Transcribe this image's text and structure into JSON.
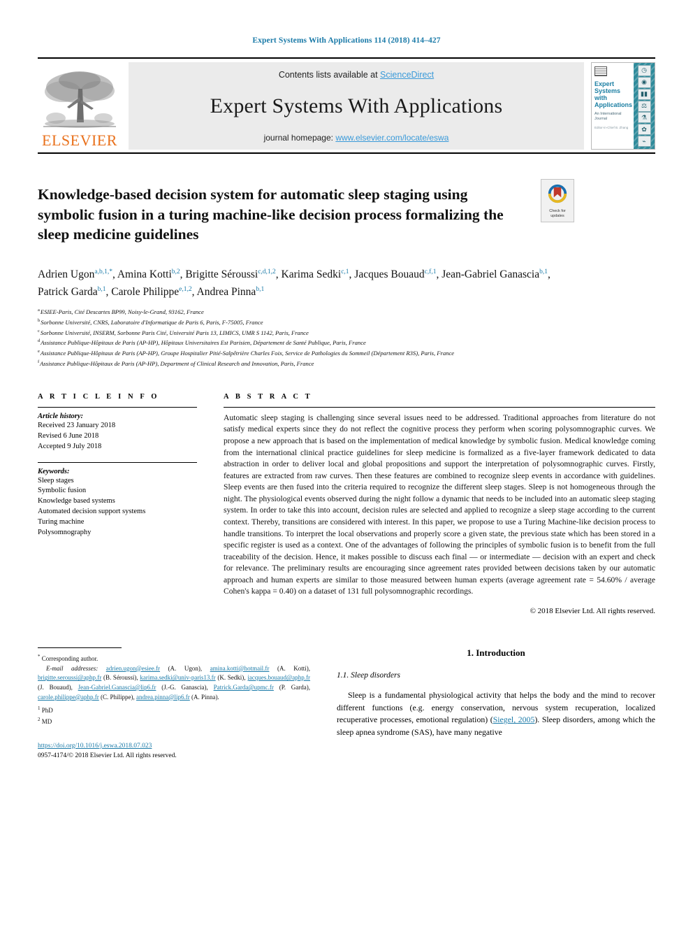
{
  "running_head": "Expert Systems With Applications 114 (2018) 414–427",
  "masthead": {
    "contents_prefix": "Contents lists available at ",
    "sciencedirect": "ScienceDirect",
    "journal_title": "Expert Systems With Applications",
    "homepage_prefix": "journal homepage: ",
    "homepage_url": "www.elsevier.com/locate/eswa",
    "publisher": "ELSEVIER",
    "cover": {
      "title": "Expert Systems with Applications",
      "subtitle": "An International Journal",
      "extra": "Editor-in-Chief\nB. Zhang",
      "icons": [
        "clock-icon",
        "globe-icon",
        "chart-icon",
        "scales-icon",
        "microscope-icon",
        "gear-icon",
        "flask-icon"
      ]
    },
    "accent_link_color": "#3a9ad9",
    "elsevier_orange": "#E9711C",
    "cover_teal": "#2f8b9b"
  },
  "title": "Knowledge-based decision system for automatic sleep staging using symbolic fusion in a turing machine-like decision process formalizing the sleep medicine guidelines",
  "crossmark": {
    "line1": "Check for",
    "line2": "updates"
  },
  "authors_html": "Adrien Ugon<sup>a,b,1,</sup><sup class=\"star\">*</sup>, Amina Kotti<sup>b,2</sup>, Brigitte Séroussi<sup>c,d,1,2</sup>, Karima Sedki<sup>c,1</sup>, Jacques Bouaud<sup>c,f,1</sup>, Jean-Gabriel Ganascia<sup>b,1</sup>, Patrick Garda<sup>b,1</sup>, Carole Philippe<sup>e,1,2</sup>, Andrea Pinna<sup>b,1</sup>",
  "affiliations": [
    {
      "marker": "a",
      "text": "ESIEE-Paris, Cité Descartes BP99, Noisy-le-Grand, 93162, France"
    },
    {
      "marker": "b",
      "text": "Sorbonne Université, CNRS, Laboratoire d'Informatique de Paris 6, Paris, F-75005, France"
    },
    {
      "marker": "c",
      "text": "Sorbonne Université, INSERM, Sorbonne Paris Cité, Université Paris 13, LIMICS, UMR S 1142, Paris, France"
    },
    {
      "marker": "d",
      "text": "Assistance Publique-Hôpitaux de Paris (AP-HP), Hôpitaux Universitaires Est Parisien, Département de Santé Publique, Paris, France"
    },
    {
      "marker": "e",
      "text": "Assistance Publique-Hôpitaux de Paris (AP-HP), Groupe Hospitalier Pitié-Salpêtrière Charles Foix, Service de Pathologies du Sommeil (Département R3S), Paris, France"
    },
    {
      "marker": "f",
      "text": "Assistance Publique-Hôpitaux de Paris (AP-HP), Department of Clinical Research and Innovation, Paris, France"
    }
  ],
  "article_info": {
    "heading": "A R T I C L E   I N F O",
    "history_label": "Article history:",
    "history": [
      "Received 23 January 2018",
      "Revised 6 June 2018",
      "Accepted 9 July 2018"
    ],
    "keywords_label": "Keywords:",
    "keywords": [
      "Sleep stages",
      "Symbolic fusion",
      "Knowledge based systems",
      "Automated decision support systems",
      "Turing machine",
      "Polysomnography"
    ]
  },
  "abstract": {
    "heading": "A B S T R A C T",
    "text": "Automatic sleep staging is challenging since several issues need to be addressed. Traditional approaches from literature do not satisfy medical experts since they do not reflect the cognitive process they perform when scoring polysomnographic curves. We propose a new approach that is based on the implementation of medical knowledge by symbolic fusion. Medical knowledge coming from the international clinical practice guidelines for sleep medicine is formalized as a five-layer framework dedicated to data abstraction in order to deliver local and global propositions and support the interpretation of polysomnographic curves. Firstly, features are extracted from raw curves. Then these features are combined to recognize sleep events in accordance with guidelines. Sleep events are then fused into the criteria required to recognize the different sleep stages. Sleep is not homogeneous through the night. The physiological events observed during the night follow a dynamic that needs to be included into an automatic sleep staging system. In order to take this into account, decision rules are selected and applied to recognize a sleep stage according to the current context. Thereby, transitions are considered with interest. In this paper, we propose to use a Turing Machine-like decision process to handle transitions. To interpret the local observations and properly score a given state, the previous state which has been stored in a specific register is used as a context. One of the advantages of following the principles of symbolic fusion is to benefit from the full traceability of the decision. Hence, it makes possible to discuss each final — or intermediate — decision with an expert and check for relevance. The preliminary results are encouraging since agreement rates provided between decisions taken by our automatic approach and human experts are similar to those measured between human experts (average agreement rate = 54.60% / average Cohen's kappa = 0.40) on a dataset of 131 full polysomnographic recordings.",
    "copyright": "© 2018 Elsevier Ltd. All rights reserved."
  },
  "footnotes": {
    "corresponding_marker": "*",
    "corresponding": "Corresponding author.",
    "email_label": "E-mail addresses:",
    "emails": [
      {
        "address": "adrien.ugon@esiee.fr",
        "who": "(A. Ugon)"
      },
      {
        "address": "amina.kotti@hotmail.fr",
        "who": "(A. Kotti)"
      },
      {
        "address": "brigitte.seroussi@aphp.fr",
        "who": "(B. Séroussi)"
      },
      {
        "address": "karima.sedki@univ-paris13.fr",
        "who": "(K. Sedki)"
      },
      {
        "address": "jacques.bouaud@aphp.fr",
        "who": "(J. Bouaud)"
      },
      {
        "address": "Jean-Gabriel.Ganascia@lip6.fr",
        "who": "(J.-G. Ganascia)"
      },
      {
        "address": "Patrick.Garda@upmc.fr",
        "who": "(P. Garda)"
      },
      {
        "address": "carole.philippe@aphp.fr",
        "who": "(C. Philippe)"
      },
      {
        "address": "andrea.pinna@lip6.fr",
        "who": "(A. Pinna)"
      }
    ],
    "note1_marker": "1",
    "note1": "PhD",
    "note2_marker": "2",
    "note2": "MD",
    "doi": "https://doi.org/10.1016/j.eswa.2018.07.023",
    "issn_line": "0957-4174/© 2018 Elsevier Ltd. All rights reserved."
  },
  "introduction": {
    "h1": "1. Introduction",
    "h2": "1.1. Sleep disorders",
    "paragraph_pre": "Sleep is a fundamental physiological activity that helps the body and the mind to recover different functions (e.g. energy conservation, nervous system recuperation, localized recuperative processes, emotional regulation) (",
    "citation": "Siegel, 2005",
    "paragraph_post": "). Sleep disorders, among which the sleep apnea syndrome (SAS), have many negative"
  }
}
